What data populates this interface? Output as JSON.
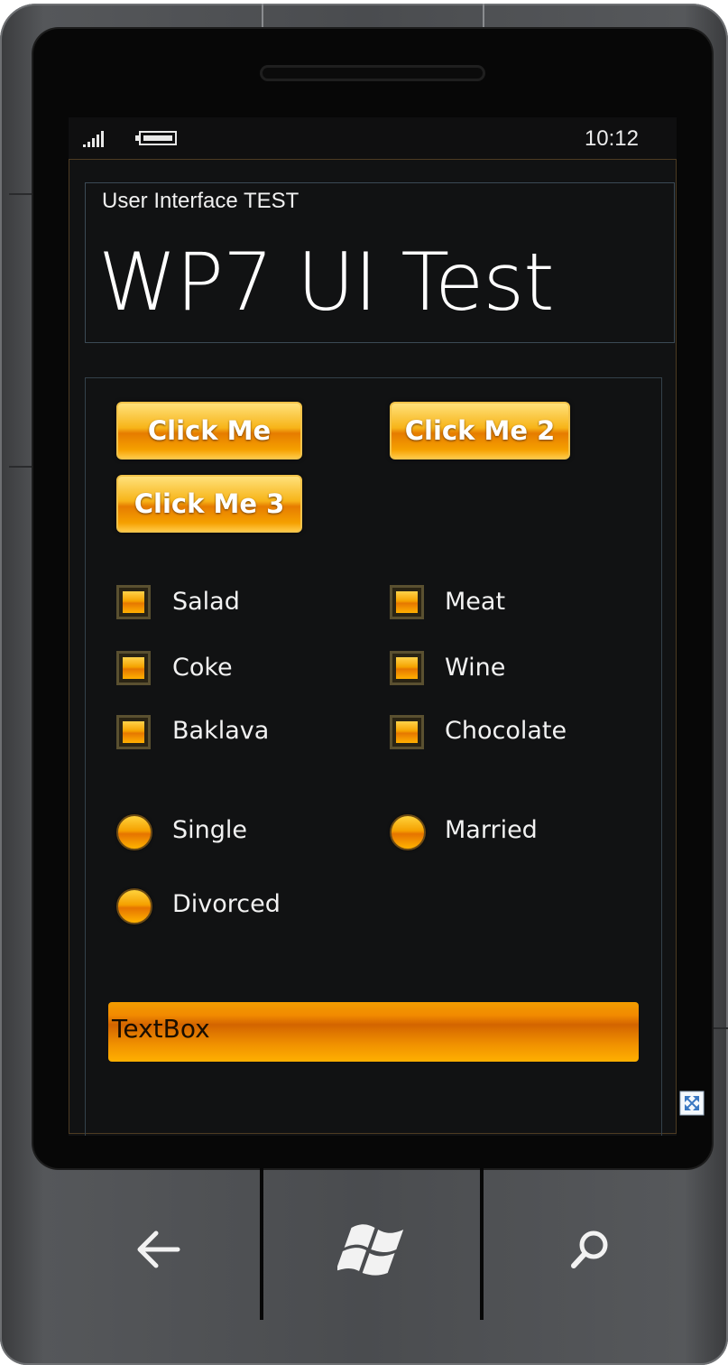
{
  "status": {
    "time": "10:12"
  },
  "app": {
    "subtitle": "User Interface TEST",
    "title": "WP7 UI Test"
  },
  "buttons": [
    {
      "label": "Click Me"
    },
    {
      "label": "Click Me 2"
    },
    {
      "label": "Click Me 3"
    }
  ],
  "checkboxes": [
    {
      "label": "Salad"
    },
    {
      "label": "Meat"
    },
    {
      "label": "Coke"
    },
    {
      "label": "Wine"
    },
    {
      "label": "Baklava"
    },
    {
      "label": "Chocolate"
    }
  ],
  "radios": [
    {
      "label": "Single"
    },
    {
      "label": "Married"
    },
    {
      "label": "Divorced"
    }
  ],
  "textbox": {
    "value": "TextBox"
  },
  "icons": {
    "signal": "signal-strength-icon",
    "battery": "battery-icon",
    "resize": "resize-icon",
    "back": "back-arrow-icon",
    "start": "windows-logo-icon",
    "search": "search-icon"
  },
  "colors": {
    "accent": "#f5a000",
    "screen_bg": "#111213",
    "text": "#ffffff"
  }
}
